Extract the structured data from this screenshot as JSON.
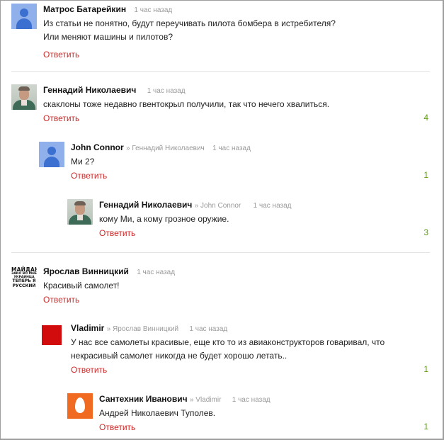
{
  "comments": [
    {
      "author": "Матрос Батарейкин",
      "reply_to": "",
      "time": "1 час назад",
      "text_lines": [
        "Из статьи не понятно, будут переучивать пилота бомбера в истребителя?",
        "Или меняют машины и пилотов?"
      ],
      "reply_label": "Ответить",
      "count": "",
      "avatar": "default-user-icon"
    },
    {
      "author": "Геннадий Николаевич",
      "reply_to": "",
      "time": "1 час назад",
      "text_lines": [
        "скаклоны тоже недавно гвентокрыл получили, так что нечего хвалиться."
      ],
      "reply_label": "Ответить",
      "count": "4",
      "avatar": "user-photo"
    },
    {
      "author": "John Connor",
      "reply_to": "» Геннадий Николаевич",
      "time": "1 час назад",
      "text_lines": [
        "Ми 2?"
      ],
      "reply_label": "Ответить",
      "count": "1",
      "avatar": "default-user-icon"
    },
    {
      "author": "Геннадий Николаевич",
      "reply_to": "» John Connor",
      "time": "1 час назад",
      "text_lines": [
        "кому Ми, а кому грозное оружие."
      ],
      "reply_label": "Ответить",
      "count": "3",
      "avatar": "user-photo"
    },
    {
      "author": "Ярослав Винницкий",
      "reply_to": "",
      "time": "1 час назад",
      "text_lines": [
        "Красивый самолет!"
      ],
      "reply_label": "Ответить",
      "count": "",
      "avatar": "text-poster-avatar",
      "avatar_text": [
        "МАЙДАН",
        "ЗАКО ВО МНЕ",
        "УКРАИНЦА",
        "ТЕПЕРЬ Я",
        "РУССКИЙ"
      ]
    },
    {
      "author": "Vladimir",
      "reply_to": "» Ярослав Винницкий",
      "time": "1 час назад",
      "text_lines": [
        "У нас все самолеты красивые, еще кто то из авиаконструкторов говаривал, что",
        "некрасивый самолет никогда не будет хорошо летать.."
      ],
      "reply_label": "Ответить",
      "count": "1",
      "avatar": "red-square-avatar"
    },
    {
      "author": "Сантехник Иванович",
      "reply_to": "» Vladimir",
      "time": "1 час назад",
      "text_lines": [
        "Андрей Николаевич Туполев."
      ],
      "reply_label": "Ответить",
      "count": "1",
      "avatar": "orange-egg-avatar"
    }
  ],
  "colors": {
    "reply_link": "#cc2a2a",
    "count": "#5aa10a",
    "meta": "#9a9a9a",
    "default_avatar_bg": "#8fb0ea",
    "default_avatar_fg": "#3b6fd0"
  }
}
